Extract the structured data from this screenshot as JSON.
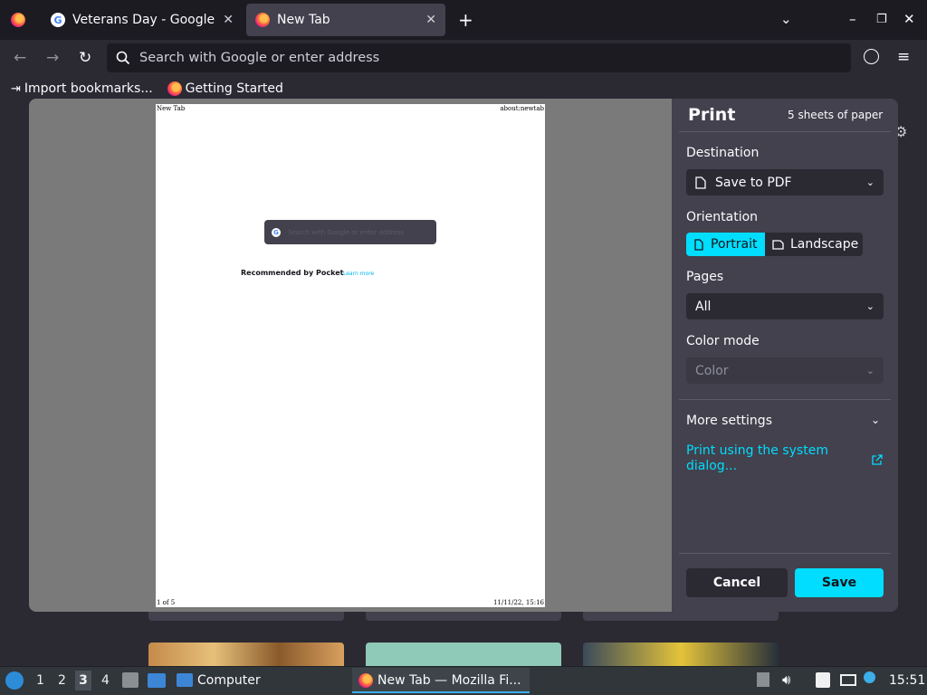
{
  "tabs": [
    {
      "title": "Veterans Day - Google Se",
      "icon": "google-icon",
      "active": false
    },
    {
      "title": "New Tab",
      "icon": "firefox-icon",
      "active": true
    }
  ],
  "toolbar": {
    "url_placeholder": "Search with Google or enter address"
  },
  "bookmarks": [
    {
      "label": "Import bookmarks...",
      "icon": "import-icon"
    },
    {
      "label": "Getting Started",
      "icon": "firefox-icon"
    }
  ],
  "preview": {
    "header_left": "New Tab",
    "header_right": "about:newtab",
    "footer_left": "1 of 5",
    "footer_right": "11/11/22, 15:16",
    "search_placeholder": "Search with Google or enter address",
    "recommended": "Recommended by Pocket",
    "learn_more": "Learn more"
  },
  "print": {
    "title": "Print",
    "sheets": "5 sheets of paper",
    "destination_label": "Destination",
    "destination_value": "Save to PDF",
    "orientation_label": "Orientation",
    "portrait": "Portrait",
    "landscape": "Landscape",
    "orientation_selected": "Portrait",
    "pages_label": "Pages",
    "pages_value": "All",
    "color_label": "Color mode",
    "color_value": "Color",
    "more_settings": "More settings",
    "system_dialog": "Print using the system dialog...",
    "cancel": "Cancel",
    "save": "Save"
  },
  "taskbar": {
    "workspaces": [
      "1",
      "2",
      "3",
      "4"
    ],
    "active_workspace": "3",
    "computer_label": "Computer",
    "window_label": "New Tab — Mozilla Fi...",
    "clock": "15:51"
  },
  "colors": {
    "accent": "#00ddff",
    "link": "#00b3f4",
    "panel_bg": "#42414d",
    "chrome_bg": "#1c1b22"
  }
}
